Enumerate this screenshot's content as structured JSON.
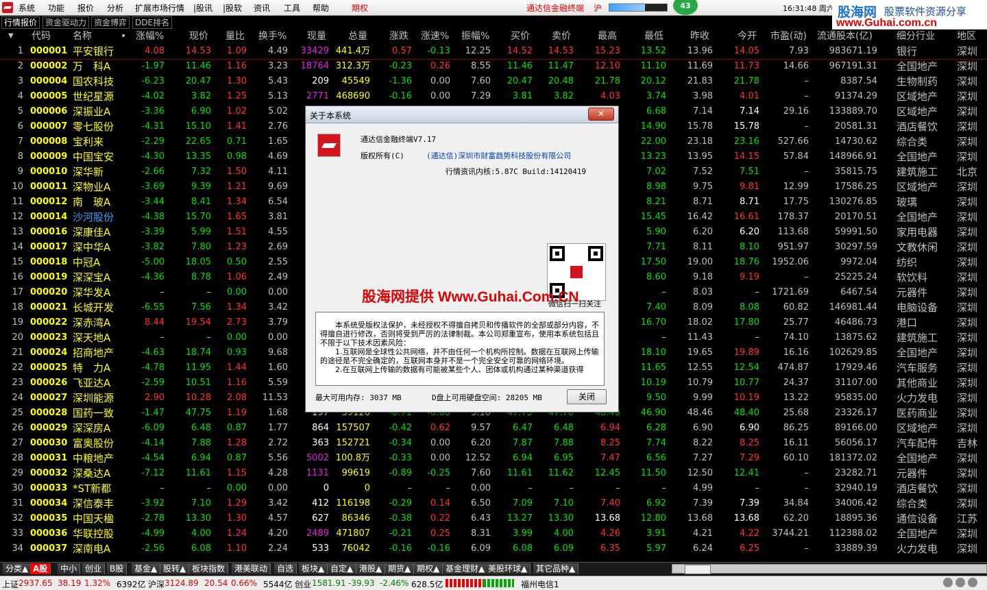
{
  "menubar": {
    "items": [
      "系统",
      "功能",
      "报价",
      "分析",
      "扩展市场行情",
      "|股讯",
      "|股软",
      "资讯",
      "工具",
      "帮助",
      "期权"
    ],
    "ticker": "通达信金融终端",
    "index_short": "沪",
    "counter": "43",
    "signal_level": 0.62,
    "clock": "16:31:48 周六"
  },
  "brand": {
    "title": "股海网",
    "tagline": "股票软件资源分享",
    "url": "www.Guhai.com.cn"
  },
  "tabs": [
    "行情报价",
    "资金驱动力",
    "资金博弈",
    "DDE排名"
  ],
  "columns": {
    "code": "代码",
    "name": "名称",
    "dot": "•",
    "pct": "涨幅%",
    "price": "现价",
    "ratio": "量比",
    "turn": "换手%",
    "vol": "现量",
    "total": "总量",
    "chg": "涨跌",
    "speed": "涨速%",
    "amp": "振幅%",
    "bid": "买价",
    "ask": "卖价",
    "high": "最高",
    "low": "最低",
    "prev": "昨收",
    "open": "今开",
    "pe": "市盈(动)",
    "float": "流通股本(亿)",
    "industry": "细分行业",
    "region": "地区"
  },
  "rows": [
    {
      "i": "1",
      "code": "000001",
      "name": "平安银行",
      "pct": "4.08",
      "price": "14.53",
      "ratio": "1.09",
      "turn": "4.49",
      "vol": "33429",
      "total": "441.4万",
      "chg": "0.57",
      "speed": "-0.13",
      "amp": "12.25",
      "bid": "14.52",
      "ask": "14.53",
      "high": "15.23",
      "low": "13.52",
      "prev": "13.96",
      "open": "14.05",
      "pe": "7.93",
      "float": "983671.19",
      "ind": "银行",
      "reg": "深圳"
    },
    {
      "i": "2",
      "code": "000002",
      "name": "万　科A",
      "pct": "-1.97",
      "price": "11.46",
      "ratio": "1.16",
      "turn": "3.23",
      "vol": "18764",
      "total": "312.3万",
      "chg": "-0.23",
      "speed": "0.26",
      "amp": "8.55",
      "bid": "11.46",
      "ask": "11.47",
      "high": "12.10",
      "low": "11.10",
      "prev": "11.69",
      "open": "11.73",
      "pe": "14.66",
      "float": "967191.31",
      "ind": "全国地产",
      "reg": "深圳"
    },
    {
      "i": "3",
      "code": "000004",
      "name": "国农科技",
      "pct": "-6.23",
      "price": "20.47",
      "ratio": "1.30",
      "turn": "5.43",
      "vol": "209",
      "total": "45549",
      "chg": "-1.36",
      "speed": "0.00",
      "amp": "7.60",
      "bid": "20.47",
      "ask": "20.48",
      "high": "21.78",
      "low": "20.12",
      "prev": "21.83",
      "open": "21.78",
      "pe": "–",
      "float": "8387.54",
      "ind": "生物制药",
      "reg": "深圳"
    },
    {
      "i": "4",
      "code": "000005",
      "name": "世纪星源",
      "pct": "-4.02",
      "price": "3.82",
      "ratio": "1.25",
      "turn": "5.13",
      "vol": "2771",
      "total": "468690",
      "chg": "-0.16",
      "speed": "0.00",
      "amp": "7.29",
      "bid": "3.81",
      "ask": "3.82",
      "high": "4.03",
      "low": "3.74",
      "prev": "3.98",
      "open": "4.01",
      "pe": "–",
      "float": "91374.29",
      "ind": "区域地产",
      "reg": "深圳"
    },
    {
      "i": "5",
      "code": "000006",
      "name": "深振业A",
      "pct": "-3.36",
      "price": "6.90",
      "ratio": "1.02",
      "turn": "5.02",
      "vol": "",
      "total": "",
      "chg": "",
      "speed": "",
      "amp": "",
      "bid": "",
      "ask": "",
      "high": "",
      "low": "6.68",
      "prev": "7.14",
      "open": "7.14",
      "pe": "29.16",
      "float": "133889.70",
      "ind": "区域地产",
      "reg": "深圳"
    },
    {
      "i": "6",
      "code": "000007",
      "name": "零七股份",
      "pct": "-4.31",
      "price": "15.10",
      "ratio": "1.41",
      "turn": "2.76",
      "vol": "",
      "total": "",
      "chg": "",
      "speed": "",
      "amp": "",
      "bid": "",
      "ask": "",
      "high": "",
      "low": "14.90",
      "prev": "15.78",
      "open": "15.78",
      "pe": "–",
      "float": "20581.31",
      "ind": "酒店餐饮",
      "reg": "深圳"
    },
    {
      "i": "7",
      "code": "000008",
      "name": "宝利来",
      "pct": "-2.29",
      "price": "22.65",
      "ratio": "0.71",
      "turn": "1.65",
      "vol": "",
      "total": "",
      "chg": "",
      "speed": "",
      "amp": "",
      "bid": "",
      "ask": "",
      "high": "",
      "low": "22.00",
      "prev": "23.18",
      "open": "23.16",
      "pe": "527.66",
      "float": "14730.62",
      "ind": "综合类",
      "reg": "深圳"
    },
    {
      "i": "8",
      "code": "000009",
      "name": "中国宝安",
      "pct": "-4.30",
      "price": "13.35",
      "ratio": "0.98",
      "turn": "4.69",
      "vol": "",
      "total": "",
      "chg": "",
      "speed": "",
      "amp": "",
      "bid": "",
      "ask": "",
      "high": "",
      "low": "13.23",
      "prev": "13.95",
      "open": "14.15",
      "pe": "57.84",
      "float": "148966.91",
      "ind": "全国地产",
      "reg": "深圳"
    },
    {
      "i": "9",
      "code": "000010",
      "name": "深华新",
      "pct": "-2.66",
      "price": "7.32",
      "ratio": "1.50",
      "turn": "4.11",
      "vol": "",
      "total": "",
      "chg": "",
      "speed": "",
      "amp": "",
      "bid": "",
      "ask": "",
      "high": "",
      "low": "7.02",
      "prev": "7.52",
      "open": "7.51",
      "pe": "–",
      "float": "35815.75",
      "ind": "建筑施工",
      "reg": "北京"
    },
    {
      "i": "10",
      "code": "000011",
      "name": "深物业A",
      "pct": "-3.69",
      "price": "9.39",
      "ratio": "1.21",
      "turn": "9.69",
      "vol": "",
      "total": "",
      "chg": "",
      "speed": "",
      "amp": "",
      "bid": "",
      "ask": "",
      "high": "",
      "low": "8.98",
      "prev": "9.75",
      "open": "9.81",
      "pe": "12.99",
      "float": "17586.25",
      "ind": "区域地产",
      "reg": "深圳"
    },
    {
      "i": "11",
      "code": "000012",
      "name": "南　玻A",
      "pct": "-3.44",
      "price": "8.41",
      "ratio": "1.34",
      "turn": "6.54",
      "vol": "",
      "total": "",
      "chg": "",
      "speed": "",
      "amp": "",
      "bid": "",
      "ask": "",
      "high": "",
      "low": "8.21",
      "prev": "8.71",
      "open": "8.71",
      "pe": "17.75",
      "float": "130276.85",
      "ind": "玻璃",
      "reg": "深圳"
    },
    {
      "i": "12",
      "code": "000014",
      "name": "沙河股份",
      "pct": "-4.38",
      "price": "15.70",
      "ratio": "1.65",
      "turn": "3.81",
      "vol": "",
      "total": "",
      "chg": "",
      "speed": "",
      "amp": "",
      "bid": "",
      "ask": "",
      "high": "",
      "low": "15.45",
      "prev": "16.42",
      "open": "16.61",
      "pe": "178.37",
      "float": "20170.51",
      "ind": "全国地产",
      "reg": "深圳"
    },
    {
      "i": "13",
      "code": "000016",
      "name": "深康佳A",
      "pct": "-3.39",
      "price": "5.99",
      "ratio": "1.51",
      "turn": "4.55",
      "vol": "",
      "total": "",
      "chg": "",
      "speed": "",
      "amp": "",
      "bid": "",
      "ask": "",
      "high": "",
      "low": "5.90",
      "prev": "6.20",
      "open": "6.20",
      "pe": "113.68",
      "float": "59991.50",
      "ind": "家用电器",
      "reg": "深圳"
    },
    {
      "i": "14",
      "code": "000017",
      "name": "深中华A",
      "pct": "-3.82",
      "price": "7.80",
      "ratio": "1.23",
      "turn": "2.69",
      "vol": "",
      "total": "",
      "chg": "",
      "speed": "",
      "amp": "",
      "bid": "",
      "ask": "",
      "high": "",
      "low": "7.71",
      "prev": "8.11",
      "open": "8.10",
      "pe": "951.97",
      "float": "30297.59",
      "ind": "文教休闲",
      "reg": "深圳"
    },
    {
      "i": "15",
      "code": "000018",
      "name": "中冠A",
      "pct": "-5.00",
      "price": "18.05",
      "ratio": "0.50",
      "turn": "2.55",
      "vol": "",
      "total": "",
      "chg": "",
      "speed": "",
      "amp": "",
      "bid": "",
      "ask": "",
      "high": "",
      "low": "17.50",
      "prev": "19.00",
      "open": "18.76",
      "pe": "1952.06",
      "float": "9972.04",
      "ind": "纺织",
      "reg": "深圳"
    },
    {
      "i": "16",
      "code": "000019",
      "name": "深深宝A",
      "pct": "-4.36",
      "price": "8.78",
      "ratio": "1.06",
      "turn": "2.49",
      "vol": "",
      "total": "",
      "chg": "",
      "speed": "",
      "amp": "",
      "bid": "",
      "ask": "",
      "high": "",
      "low": "8.60",
      "prev": "9.18",
      "open": "9.19",
      "pe": "–",
      "float": "25225.24",
      "ind": "软饮料",
      "reg": "深圳"
    },
    {
      "i": "17",
      "code": "000020",
      "name": "深华发A",
      "pct": "–",
      "price": "–",
      "ratio": "0.00",
      "turn": "0.00",
      "vol": "",
      "total": "",
      "chg": "",
      "speed": "",
      "amp": "",
      "bid": "",
      "ask": "",
      "high": "",
      "low": "–",
      "prev": "8.03",
      "open": "–",
      "pe": "1721.69",
      "float": "6467.54",
      "ind": "元器件",
      "reg": "深圳"
    },
    {
      "i": "18",
      "code": "000021",
      "name": "长城开发",
      "pct": "-6.55",
      "price": "7.56",
      "ratio": "1.34",
      "turn": "3.42",
      "vol": "",
      "total": "",
      "chg": "",
      "speed": "",
      "amp": "",
      "bid": "",
      "ask": "",
      "high": "",
      "low": "7.40",
      "prev": "8.09",
      "open": "8.08",
      "pe": "60.82",
      "float": "146981.44",
      "ind": "电脑设备",
      "reg": "深圳"
    },
    {
      "i": "19",
      "code": "000022",
      "name": "深赤湾A",
      "pct": "8.44",
      "price": "19.54",
      "ratio": "2.73",
      "turn": "3.79",
      "vol": "",
      "total": "",
      "chg": "",
      "speed": "",
      "amp": "",
      "bid": "",
      "ask": "",
      "high": "",
      "low": "16.70",
      "prev": "18.02",
      "open": "17.80",
      "pe": "25.77",
      "float": "46486.73",
      "ind": "港口",
      "reg": "深圳"
    },
    {
      "i": "20",
      "code": "000023",
      "name": "深天地A",
      "pct": "–",
      "price": "–",
      "ratio": "0.00",
      "turn": "0.00",
      "vol": "",
      "total": "",
      "chg": "",
      "speed": "",
      "amp": "",
      "bid": "",
      "ask": "",
      "high": "",
      "low": "–",
      "prev": "11.43",
      "open": "–",
      "pe": "74.10",
      "float": "13875.62",
      "ind": "建筑施工",
      "reg": "深圳"
    },
    {
      "i": "21",
      "code": "000024",
      "name": "招商地产",
      "pct": "-4.63",
      "price": "18.74",
      "ratio": "0.93",
      "turn": "9.68",
      "vol": "",
      "total": "",
      "chg": "",
      "speed": "",
      "amp": "",
      "bid": "",
      "ask": "",
      "high": "",
      "low": "18.10",
      "prev": "19.65",
      "open": "19.89",
      "pe": "16.16",
      "float": "102629.85",
      "ind": "全国地产",
      "reg": "深圳"
    },
    {
      "i": "22",
      "code": "000025",
      "name": "特　力A",
      "pct": "-4.78",
      "price": "11.95",
      "ratio": "1.44",
      "turn": "1.60",
      "vol": "",
      "total": "",
      "chg": "",
      "speed": "",
      "amp": "",
      "bid": "",
      "ask": "",
      "high": "",
      "low": "11.65",
      "prev": "12.55",
      "open": "12.54",
      "pe": "474.87",
      "float": "17929.46",
      "ind": "汽车服务",
      "reg": "深圳"
    },
    {
      "i": "23",
      "code": "000026",
      "name": "飞亚达A",
      "pct": "-2.59",
      "price": "10.51",
      "ratio": "1.16",
      "turn": "5.59",
      "vol": "",
      "total": "",
      "chg": "",
      "speed": "",
      "amp": "",
      "bid": "",
      "ask": "",
      "high": "",
      "low": "10.19",
      "prev": "10.79",
      "open": "10.77",
      "pe": "24.37",
      "float": "31107.00",
      "ind": "其他商业",
      "reg": "深圳"
    },
    {
      "i": "24",
      "code": "000027",
      "name": "深圳能源",
      "pct": "2.90",
      "price": "10.28",
      "ratio": "2.08",
      "turn": "11.53",
      "vol": "",
      "total": "",
      "chg": "",
      "speed": "",
      "amp": "",
      "bid": "",
      "ask": "",
      "high": "",
      "low": "9.50",
      "prev": "9.99",
      "open": "10.19",
      "pe": "13.22",
      "float": "95835.00",
      "ind": "火力发电",
      "reg": "深圳"
    },
    {
      "i": "25",
      "code": "000028",
      "name": "国药一致",
      "pct": "-1.47",
      "price": "47.75",
      "ratio": "1.19",
      "turn": "1.68",
      "vol": "197",
      "total": "39126",
      "chg": "-0.71",
      "speed": "-0.06",
      "amp": "3.10",
      "bid": "47.75",
      "ask": "47.76",
      "high": "48.40",
      "low": "46.90",
      "prev": "48.46",
      "open": "48.40",
      "pe": "25.68",
      "float": "23326.17",
      "ind": "医药商业",
      "reg": "深圳"
    },
    {
      "i": "26",
      "code": "000029",
      "name": "深深房A",
      "pct": "-6.09",
      "price": "6.48",
      "ratio": "0.87",
      "turn": "1.77",
      "vol": "864",
      "total": "157507",
      "chg": "-0.42",
      "speed": "0.62",
      "amp": "9.57",
      "bid": "6.47",
      "ask": "6.48",
      "high": "6.94",
      "low": "6.28",
      "prev": "6.90",
      "open": "6.90",
      "pe": "86.25",
      "float": "89166.00",
      "ind": "区域地产",
      "reg": "深圳"
    },
    {
      "i": "27",
      "code": "000030",
      "name": "富奥股份",
      "pct": "-4.14",
      "price": "7.88",
      "ratio": "1.28",
      "turn": "2.72",
      "vol": "363",
      "total": "152721",
      "chg": "-0.34",
      "speed": "0.00",
      "amp": "6.20",
      "bid": "7.87",
      "ask": "7.88",
      "high": "8.25",
      "low": "7.74",
      "prev": "8.22",
      "open": "8.25",
      "pe": "16.11",
      "float": "56056.17",
      "ind": "汽车配件",
      "reg": "吉林"
    },
    {
      "i": "28",
      "code": "000031",
      "name": "中粮地产",
      "pct": "-4.54",
      "price": "6.94",
      "ratio": "0.87",
      "turn": "5.56",
      "vol": "5002",
      "total": "100.8万",
      "chg": "-0.33",
      "speed": "0.00",
      "amp": "12.52",
      "bid": "6.94",
      "ask": "6.95",
      "high": "7.47",
      "low": "6.56",
      "prev": "7.27",
      "open": "7.29",
      "pe": "60.10",
      "float": "181372.02",
      "ind": "全国地产",
      "reg": "深圳"
    },
    {
      "i": "29",
      "code": "000032",
      "name": "深桑达A",
      "pct": "-7.12",
      "price": "11.61",
      "ratio": "1.15",
      "turn": "4.28",
      "vol": "1131",
      "total": "99619",
      "chg": "-0.89",
      "speed": "-0.25",
      "amp": "7.60",
      "bid": "11.61",
      "ask": "11.62",
      "high": "12.45",
      "low": "11.50",
      "prev": "12.50",
      "open": "12.41",
      "pe": "–",
      "float": "23282.71",
      "ind": "元器件",
      "reg": "深圳"
    },
    {
      "i": "30",
      "code": "000033",
      "name": "*ST新都",
      "pct": "–",
      "price": "–",
      "ratio": "0.00",
      "turn": "0.00",
      "vol": "0",
      "total": "0",
      "chg": "–",
      "speed": "–",
      "amp": "0.00",
      "bid": "–",
      "ask": "–",
      "high": "–",
      "low": "–",
      "prev": "4.99",
      "open": "–",
      "pe": "–",
      "float": "32940.19",
      "ind": "酒店餐饮",
      "reg": "深圳"
    },
    {
      "i": "31",
      "code": "000034",
      "name": "深信泰丰",
      "pct": "-3.92",
      "price": "7.10",
      "ratio": "1.29",
      "turn": "3.42",
      "vol": "412",
      "total": "116198",
      "chg": "-0.29",
      "speed": "0.14",
      "amp": "6.50",
      "bid": "7.09",
      "ask": "7.10",
      "high": "7.40",
      "low": "6.92",
      "prev": "7.39",
      "open": "7.39",
      "pe": "34.84",
      "float": "34006.42",
      "ind": "综合类",
      "reg": "深圳"
    },
    {
      "i": "32",
      "code": "000035",
      "name": "中国天楹",
      "pct": "-2.78",
      "price": "13.30",
      "ratio": "1.30",
      "turn": "4.57",
      "vol": "627",
      "total": "86346",
      "chg": "-0.38",
      "speed": "0.22",
      "amp": "6.43",
      "bid": "13.27",
      "ask": "13.30",
      "high": "13.68",
      "low": "12.80",
      "prev": "13.68",
      "open": "13.68",
      "pe": "62.20",
      "float": "18895.36",
      "ind": "通信设备",
      "reg": "江苏"
    },
    {
      "i": "33",
      "code": "000036",
      "name": "华联控股",
      "pct": "-4.99",
      "price": "4.00",
      "ratio": "1.24",
      "turn": "4.20",
      "vol": "2489",
      "total": "471807",
      "chg": "-0.21",
      "speed": "0.25",
      "amp": "8.31",
      "bid": "3.99",
      "ask": "4.00",
      "high": "4.26",
      "low": "3.91",
      "prev": "4.21",
      "open": "4.22",
      "pe": "3744.21",
      "float": "112388.02",
      "ind": "全国地产",
      "reg": "深圳"
    },
    {
      "i": "34",
      "code": "000037",
      "name": "深南电A",
      "pct": "-2.56",
      "price": "6.08",
      "ratio": "1.10",
      "turn": "2.24",
      "vol": "533",
      "total": "76042",
      "chg": "-0.16",
      "speed": "-0.16",
      "amp": "6.09",
      "bid": "6.08",
      "ask": "6.09",
      "high": "6.35",
      "low": "5.97",
      "prev": "6.24",
      "open": "6.25",
      "pe": "–",
      "float": "33889.39",
      "ind": "火力发电",
      "reg": "深圳"
    }
  ],
  "dialog": {
    "title": "关于本系统",
    "close_glyph": "✕",
    "product": "通达信金融终端V7.17",
    "copyright": "版权所有(C)",
    "company": "(通达信)深圳市财富趋势科技股份有限公司",
    "kernel": "行情资讯内核:5.87C Build:14120419",
    "qr_caption": "微信扫一扫关注",
    "watermark": "股海网提供 Www.Guhai.Com.CN",
    "legal1": "本系统受版权法保护，未经授权不得擅自拷贝和传播软件的全部或部分内容，不得擅自进行修改，否则将受到严厉的法律制裁。本公司郑重宣布，使用本系统包括且不限于以下技术因素风险：",
    "legal2": "1.互联网是全球性公共网络，并不由任何一个机构所控制。数据在互联网上传输的途径是不完全确定的，互联网本身并不是一个完全安全可靠的网络环境。",
    "legal3": "2.在互联网上传输的数据有可能被某些个人、团体或机构通过某种渠道获得",
    "memory": "最大可用内存: 3037 MB",
    "disk": "D盘上可用硬盘空间: 28205 MB",
    "ok": "关闭"
  },
  "bottom_tabs": [
    "分类▲",
    "A股",
    "中小",
    "创业",
    "B股",
    "基金▲",
    "股转▲",
    "板块指数",
    "港美联动",
    "自选",
    "板块▲",
    "自定▲",
    "港股▲",
    "期货▲",
    "期权▲",
    "基金理财▲",
    "美股环球▲",
    "其它品种▲"
  ],
  "status": {
    "sh_label": "上证",
    "sh_val": "2937.65",
    "sh_chg": "38.19",
    "sh_pct": "1.32%",
    "sh_amt": "6392亿",
    "sz_label": "沪深",
    "sz_val": "3124.89",
    "sz_chg": "20.54",
    "sz_pct": "0.66%",
    "sz_amt": "5544亿",
    "cy_label": "创业",
    "cy_val": "1581.91",
    "cy_chg": "-39.93",
    "cy_pct": "-2.46%",
    "cy_amt": "628.5亿",
    "server": "福州电信1"
  }
}
